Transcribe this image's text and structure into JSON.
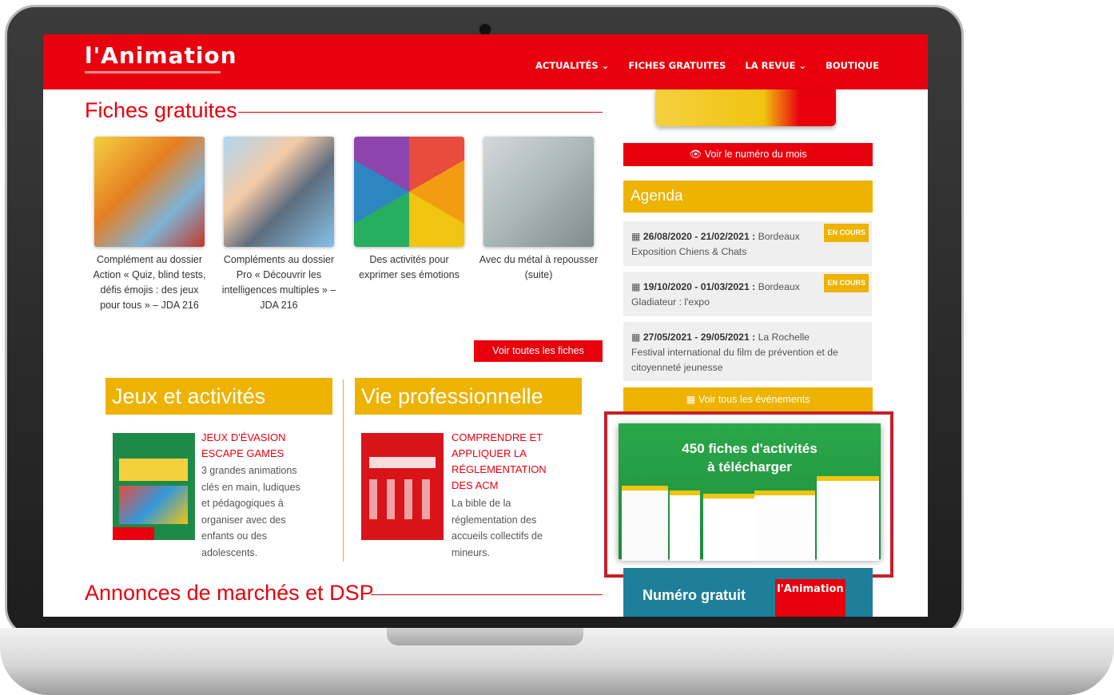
{
  "header": {
    "logo": "l'Animation",
    "nav": [
      "ACTUALITÉS ⌄",
      "FICHES GRATUITES",
      "LA REVUE ⌄",
      "BOUTIQUE"
    ]
  },
  "fiches": {
    "title": "Fiches gratuites",
    "items": [
      {
        "caption": "Complément au dossier Action « Quiz, blind tests, défis émojis : des jeux pour tous » – JDA 216"
      },
      {
        "caption": "Compléments au dossier Pro « Découvrir les intelligences multiples » – JDA 216"
      },
      {
        "caption": "Des activités pour exprimer ses émotions"
      },
      {
        "caption": "Avec du métal à repousser (suite)"
      }
    ],
    "all_button": "Voir toutes les fiches"
  },
  "jeux": {
    "title": "Jeux et activités",
    "article_title": "JEUX D'ÉVASION ESCAPE GAMES",
    "article_text": "3 grandes animations clés en main, ludiques et pédagogiques à organiser avec des enfants ou des adolescents."
  },
  "vie": {
    "title": "Vie professionnelle",
    "article_title": "COMPRENDRE ET APPLIQUER LA RÉGLEMENTATION DES ACM",
    "article_text": "La bible de la réglementation des accueils collectifs de mineurs."
  },
  "annonces": {
    "title": "Annonces de marchés et DSP"
  },
  "sidebar": {
    "month_button": "Voir le numéro du mois",
    "agenda_title": "Agenda",
    "events": [
      {
        "date": "26/08/2020 - 21/02/2021 :",
        "place": "Bordeaux",
        "name": "Exposition Chiens & Chats",
        "badge": "EN COURS"
      },
      {
        "date": "19/10/2020 - 01/03/2021 :",
        "place": "Bordeaux",
        "name": "Gladiateur : l'expo",
        "badge": "EN COURS"
      },
      {
        "date": "27/05/2021 - 29/05/2021 :",
        "place": "La Rochelle",
        "name": "Festival international du film de prévention et de citoyenneté jeunesse",
        "badge": ""
      }
    ],
    "all_events": "Voir tous les événements",
    "promo_line1": "450 fiches d'activités",
    "promo_line2": "à télécharger",
    "free_issue": "Numéro gratuit",
    "free_issue_logo": "l'Animation"
  },
  "colors": {
    "red": "#e8000d",
    "yellow": "#eeb200",
    "green": "#2aa84a",
    "teal": "#1d7f99"
  }
}
